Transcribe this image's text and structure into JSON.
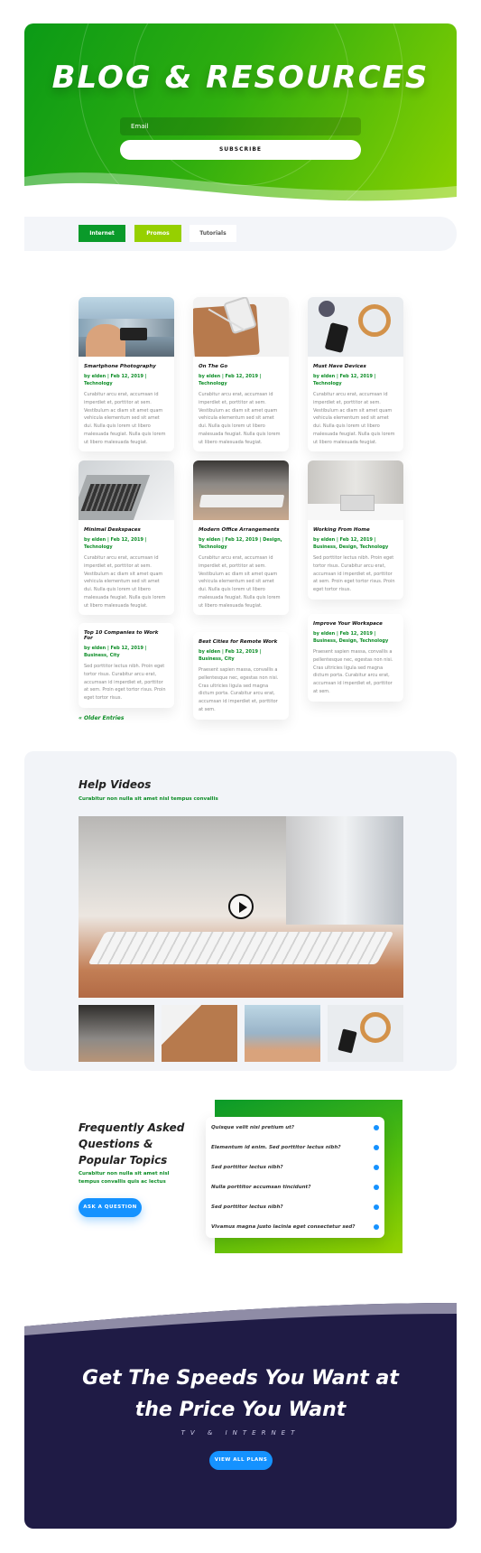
{
  "hero": {
    "title": "BLOG & RESOURCES",
    "email_placeholder": "Email",
    "subscribe_label": "SUBSCRIBE"
  },
  "tabs": [
    "Internet",
    "Promos",
    "Tutorials"
  ],
  "posts": [
    {
      "title": "Smartphone Photography",
      "meta": "by elden | Feb 12, 2019 | Technology",
      "excerpt": "Curabitur arcu erat, accumsan id imperdiet et, porttitor at sem. Vestibulum ac diam sit amet quam vehicula elementum sed sit amet dui. Nulla quis lorem ut libero malesuada feugiat. Nulla quis lorem ut libero malesuada feugiat."
    },
    {
      "title": "On The Go",
      "meta": "by elden | Feb 12, 2019 | Technology",
      "excerpt": "Curabitur arcu erat, accumsan id imperdiet et, porttitor at sem. Vestibulum ac diam sit amet quam vehicula elementum sed sit amet dui. Nulla quis lorem ut libero malesuada feugiat. Nulla quis lorem ut libero malesuada feugiat."
    },
    {
      "title": "Must Have Devices",
      "meta": "by elden | Feb 12, 2019 | Technology",
      "excerpt": "Curabitur arcu erat, accumsan id imperdiet et, porttitor at sem. Vestibulum ac diam sit amet quam vehicula elementum sed sit amet dui. Nulla quis lorem ut libero malesuada feugiat. Nulla quis lorem ut libero malesuada feugiat."
    },
    {
      "title": "Minimal Deskspaces",
      "meta": "by elden | Feb 12, 2019 | Technology",
      "excerpt": "Curabitur arcu erat, accumsan id imperdiet et, porttitor at sem. Vestibulum ac diam sit amet quam vehicula elementum sed sit amet dui. Nulla quis lorem ut libero malesuada feugiat. Nulla quis lorem ut libero malesuada feugiat."
    },
    {
      "title": "Modern Office Arrangements",
      "meta": "by elden | Feb 12, 2019 | Design, Technology",
      "excerpt": "Curabitur arcu erat, accumsan id imperdiet et, porttitor at sem. Vestibulum ac diam sit amet quam vehicula elementum sed sit amet dui. Nulla quis lorem ut libero malesuada feugiat. Nulla quis lorem ut libero malesuada feugiat."
    },
    {
      "title": "Working From Home",
      "meta": "by elden | Feb 12, 2019 | Business, Design, Technology",
      "excerpt": "Sed porttitor lectus nibh. Proin eget tortor risus. Curabitur arcu erat, accumsan id imperdiet et, porttitor at sem. Proin eget tortor risus. Proin eget tortor risus."
    },
    {
      "title": "Top 10 Companies to Work For",
      "meta": "by elden | Feb 12, 2019 | Business, City",
      "excerpt": "Sed porttitor lectus nibh. Proin eget tortor risus. Curabitur arcu erat, accumsan id imperdiet et, porttitor at sem. Proin eget tortor risus. Proin eget tortor risus."
    },
    {
      "title": "Best Cities for Remote Work",
      "meta": "by elden | Feb 12, 2019 | Business, City",
      "excerpt": "Praesent sapien massa, convallis a pellentesque nec, egestas non nisi. Cras ultricies ligula sed magna dictum porta. Curabitur arcu erat, accumsan id imperdiet et, porttitor at sem."
    },
    {
      "title": "Improve Your Workspace",
      "meta": "by elden | Feb 12, 2019 | Business, Design, Technology",
      "excerpt": "Praesent sapien massa, convallis a pellentesque nec, egestas non nisi. Cras ultricies ligula sed magna dictum porta. Curabitur arcu erat, accumsan id imperdiet et, porttitor at sem."
    }
  ],
  "older_entries": "« Older Entries",
  "help": {
    "title": "Help Videos",
    "subtitle": "Curabitur non nulla sit amet nisl tempus convallis"
  },
  "faq": {
    "title": "Frequently Asked Questions & Popular Topics",
    "subtitle": "Curabitur non nulla sit amet nisl tempus convallis quis ac lectus",
    "button": "ASK A QUESTION",
    "items": [
      "Quisque velit nisi pretium ut?",
      "Elementum id enim. Sed porttitor lectus nibh?",
      "Sed porttitor lectus nibh?",
      "Nulla porttitor accumsan tincidunt?",
      "Sed porttitor lectus nibh?",
      "Vivamus magna justo lacinia eget consectetur sed?"
    ]
  },
  "cta": {
    "title_line1": "Get The Speeds You Want at",
    "title_line2": "the Price You Want",
    "subtitle": "TV & INTERNET",
    "button": "VIEW ALL PLANS"
  },
  "colors": {
    "green": "#0a9a2a",
    "lime": "#96d000",
    "blue": "#1592ff",
    "navy": "#1f1b45"
  }
}
